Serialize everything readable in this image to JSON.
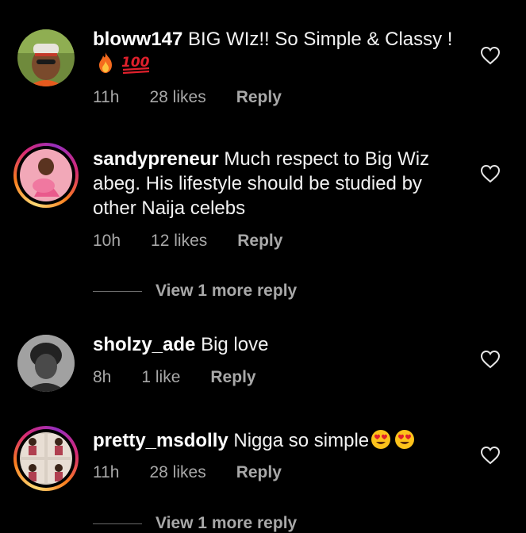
{
  "comments": [
    {
      "username": "bloww147",
      "text": "BIG WIz!! So Simple & Classy !",
      "emojis": [
        "fire",
        "hundred-points"
      ],
      "time": "11h",
      "likes": "28 likes",
      "reply": "Reply"
    },
    {
      "username": "sandypreneur",
      "text": "Much respect to Big Wiz abeg. His lifestyle should be studied by other Naija celebs",
      "time": "10h",
      "likes": "12 likes",
      "reply": "Reply",
      "view_more": "View 1 more reply"
    },
    {
      "username": "sholzy_ade",
      "text": "Big love",
      "time": "8h",
      "likes": "1 like",
      "reply": "Reply"
    },
    {
      "username": "pretty_msdolly",
      "text": "Nigga so simple",
      "emojis": [
        "heart-eyes",
        "heart-eyes"
      ],
      "time": "11h",
      "likes": "28 likes",
      "reply": "Reply",
      "view_more": "View 1 more reply"
    }
  ],
  "colors": {
    "background": "#000000",
    "text": "#f2f2f2",
    "secondary": "#a8a8a8"
  },
  "icons": {
    "like": "heart-outline-icon"
  }
}
